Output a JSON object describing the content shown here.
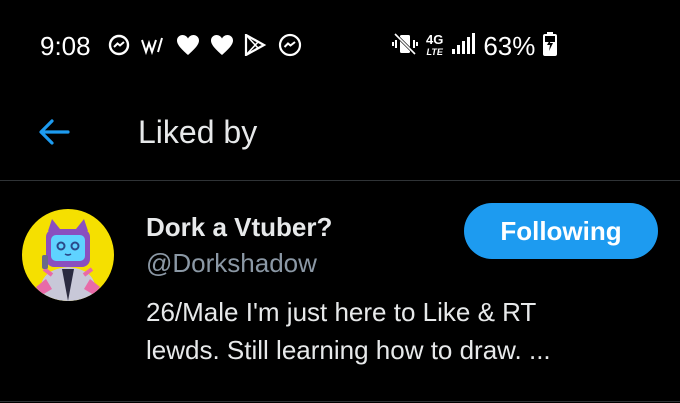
{
  "status_bar": {
    "time": "9:08",
    "network_top": "4G",
    "network_bottom": "LTE",
    "battery": "63%",
    "left_icons": [
      "messenger-icon",
      "wifi-calling-icon",
      "heart-icon",
      "heart-icon",
      "play-store-icon",
      "messenger-icon"
    ],
    "right_icons": [
      "vibrate-icon",
      "signal-icon",
      "battery-icon"
    ]
  },
  "header": {
    "title": "Liked by",
    "back_icon": "arrow-left-icon"
  },
  "user": {
    "name": "Dork a Vtuber?",
    "handle": "@Dorkshadow",
    "follow_label": "Following",
    "bio_line1": "26/Male I'm just here to Like & RT",
    "bio_line2": "lewds. Still learning how to draw. ..."
  },
  "colors": {
    "background": "#000000",
    "accent": "#1d9bf0",
    "secondary_text": "#8b98a5",
    "avatar_bg": "#f5e000"
  }
}
